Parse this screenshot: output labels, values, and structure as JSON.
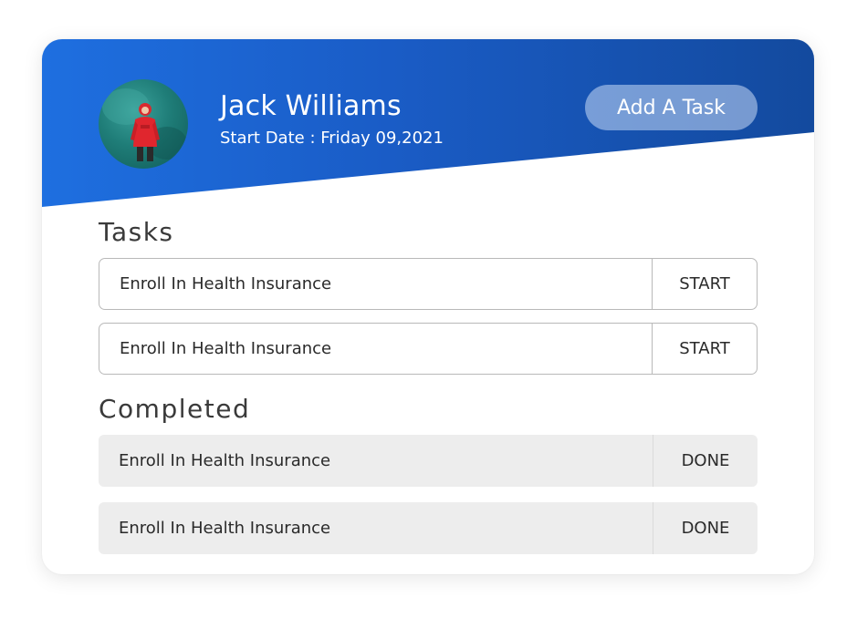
{
  "profile": {
    "name": "Jack Williams",
    "start_date": "Start Date : Friday 09,2021"
  },
  "header": {
    "add_task_label": "Add A Task"
  },
  "tasks": {
    "title": "Tasks",
    "items": [
      {
        "label": "Enroll In Health Insurance",
        "action": "START"
      },
      {
        "label": "Enroll In Health Insurance",
        "action": "START"
      }
    ]
  },
  "completed": {
    "title": "Completed",
    "items": [
      {
        "label": "Enroll In Health Insurance",
        "action": "DONE"
      },
      {
        "label": "Enroll In Health Insurance",
        "action": "DONE"
      }
    ]
  },
  "colors": {
    "header_start": "#1e6fe0",
    "header_end": "#134a9e",
    "done_row_bg": "#ededed",
    "avatar_jacket": "#e0262e"
  }
}
